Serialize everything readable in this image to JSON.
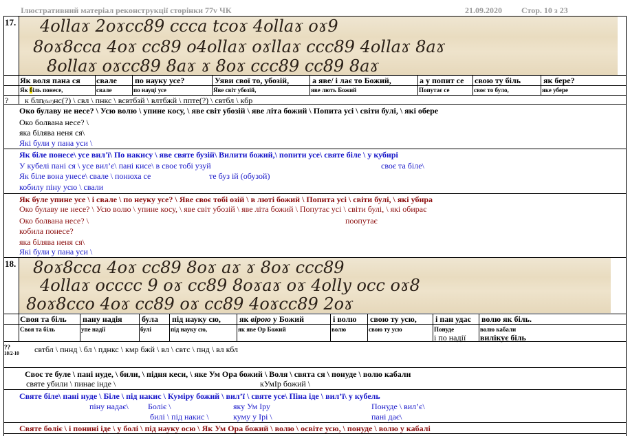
{
  "header": {
    "title": "Ілюстративний матеріал  реконструкції сторінки 77v ЧК",
    "date": "21.09.2020",
    "page": "Стор. 10 з 23"
  },
  "section17": {
    "number": "17.",
    "scan_lines": [
      "4ollaɤ 2oɤcc89 ccca tcoɤ 4ollaɤ oɤ9",
      "8oɤ8cca 4oɤ cc89 o4ollaɤ oɤllaɤ ccc89 4ollaɤ 8aɤ",
      "8ollaɤ oɤcc89 8aɤ ɤ 8oɤ ccc89 cc89 8aɤ"
    ],
    "headers": [
      "Як воля пана ся",
      "свале",
      "по науку усе?",
      "Уяви свої то, убозій,",
      "а яве/ і лає то Божий,",
      "а у попит се",
      "свою ту біль",
      "як бере?"
    ],
    "subheaders_prefix": "Як ",
    "subheaders_mark": "б",
    "subheaders_rest": "іль понесе,",
    "subheaders": [
      "свале",
      "по науці усе",
      "Яве світ убозій,",
      "яве лють Божий",
      "Попутає се",
      "своє то було,",
      "яке убере"
    ],
    "row_marker": "?",
    "translit_a": "к блп",
    "translit_sub": "(бн?)",
    "translit_b": "нс(?)   \\   свл   \\   пнкс   \\    всвтбзй      \\      влтбжй      \\       ппте(?)    \\    свтбл    \\    кбр",
    "block1": {
      "bold": "Око булаву не несе? \\ Усю волю \\ упине косу, \\ яве світ убозій \\ яве літа божий \\ Попита усі \\  світи булі, \\  які обере",
      "lines": [
        "Око болвана несе? \\",
        "яка білява неня ся\\"
      ],
      "blue": "Які були у пана уси \\"
    },
    "block2": {
      "bold": "Як біле понесе\\ усе вил'ї\\ По накису \\ яве святе бузій\\ Вилити божий,\\ попити усе\\ святе біле \\ у кубирі",
      "l1a": "У кубелі пані ся \\ усе вил’є\\  пані кисе\\     в своє тобі узуй",
      "l1b": "своє та біле\\",
      "l2a": "Як біле вона унесе\\  свале \\    понюха се",
      "l2b": "те буз ій (обузой)",
      "l3": "кобилу піну усю \\ свали"
    },
    "block3": {
      "bold": "Як буле упине усе \\ і свале \\ по неуку усе? \\ Яве своє тобі озій \\ в люті божий \\ Попита усі \\  світи булі, \\  які убира",
      "l1": "Око булаву не несе? \\ Усю волю \\ упине косу, \\ яве світ убозій \\ яве літа божий \\  Попутає усі \\  світи булі, \\  які обирає",
      "l2a": "Око болвана несе? \\",
      "l2b": "поопутає",
      "l3": "кобила  понесе?",
      "l4": "яка білява неня ся\\",
      "l5": "Які були у пана уси \\"
    }
  },
  "section18": {
    "number": "18.",
    "scan_lines": [
      "8oɤ8cca 4oɤ cc89 8oɤ aɤ ɤ 8oɤ ccc89",
      "4ollaɤ occcc 9 oɤ cc89 8oɤaɤ oɤ 4olly occ oɤ8",
      "8oɤ8cco 4oɤ cc89 oɤ cc89 4oɤcc89 2oɤ"
    ],
    "h_pre": "Своя та біль",
    "headers2": [
      "пану надія",
      "була",
      "під науку сю,"
    ],
    "h5_pre": "як ",
    "h5_em": "вірою",
    "h5_post": " у Божий",
    "headers2b": [
      "і волю",
      "свою ту усю,",
      "і пан удає",
      "волю як біль."
    ],
    "sub2": [
      "Своя та біль",
      "упе надії",
      "булі",
      "під науку сю,",
      "як яве Ор Божий",
      "волю",
      "свою ту усю",
      "Понуде",
      "волю кабали"
    ],
    "sub2_b": "і по надії",
    "sub2_c": "вилікує біль",
    "row_marker": "??",
    "row_marker_small": "18/2-10",
    "translit": "свтбл          \\              пннд          \\          бл         \\          пднкс        \\                    кмр      бжй      \\          вл       \\      свтс        \\            пнд         \\          вл кбл",
    "block1": {
      "bold": "Своє те буле \\    пані нуде, \\  били, \\ підня кеси, \\  яке Ум Ора божий \\  Воля \\  свята ся \\  понуде \\    волю кабали",
      "l2a": "святе убили \\     пинає інде \\",
      "l2b": "кУмІр божий \\"
    },
    "block2": {
      "bold": "Святе біле\\          пані нуде \\       Біле \\ під накис \\   Куміру божий \\ вил’ї \\ святе усе\\ Піна іде \\ вил’ї\\ у кубель",
      "l2a": "піну надає\\",
      "l2b": "Боліє \\",
      "l2c": "яку Ум Іру",
      "l2d": "Понуде \\ вил’є\\",
      "l3a": "билі \\ під накис \\",
      "l3b": "куму у Ірі \\",
      "l3c": "пані дає\\"
    },
    "block3": {
      "bold": "Святе боліє \\     і понині іде \\  у  болі \\  під науку осю \\ Як Ум Ора божий \\ волю \\  освіте усю, \\  понуде \\ волю у кабалі"
    }
  }
}
